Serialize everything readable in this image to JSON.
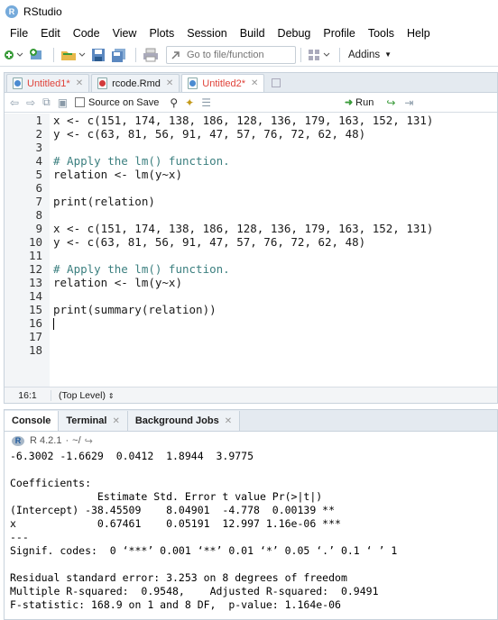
{
  "window": {
    "title": "RStudio"
  },
  "menu": [
    "File",
    "Edit",
    "Code",
    "View",
    "Plots",
    "Session",
    "Build",
    "Debug",
    "Profile",
    "Tools",
    "Help"
  ],
  "toolbar": {
    "goto_placeholder": "Go to file/function",
    "addins_label": "Addins"
  },
  "editor_tabs": [
    {
      "label": "Untitled1*",
      "modified": true
    },
    {
      "label": "rcode.Rmd",
      "modified": false
    },
    {
      "label": "Untitled2*",
      "modified": true,
      "active": true
    }
  ],
  "editor_toolbar": {
    "source_on_save": "Source on Save",
    "run_label": "Run"
  },
  "code_lines": [
    "x <- c(151, 174, 138, 186, 128, 136, 179, 163, 152, 131)",
    "y <- c(63, 81, 56, 91, 47, 57, 76, 72, 62, 48)",
    "",
    "# Apply the lm() function.",
    "relation <- lm(y~x)",
    "",
    "print(relation)",
    "",
    "x <- c(151, 174, 138, 186, 128, 136, 179, 163, 152, 131)",
    "y <- c(63, 81, 56, 91, 47, 57, 76, 72, 62, 48)",
    "",
    "# Apply the lm() function.",
    "relation <- lm(y~x)",
    "",
    "print(summary(relation))",
    "",
    "",
    ""
  ],
  "line_numbers": [
    "1",
    "2",
    "3",
    "4",
    "5",
    "6",
    "7",
    "8",
    "9",
    "10",
    "11",
    "12",
    "13",
    "14",
    "15",
    "16",
    "17",
    "18"
  ],
  "status": {
    "cursor": "16:1",
    "scope": "(Top Level)"
  },
  "console_tabs": [
    "Console",
    "Terminal",
    "Background Jobs"
  ],
  "console_header": {
    "r_version": "R 4.2.1",
    "path": "~/"
  },
  "console_lines": [
    "-6.3002 -1.6629  0.0412  1.8944  3.9775",
    "",
    "Coefficients:",
    "              Estimate Std. Error t value Pr(>|t|)",
    "(Intercept) -38.45509    8.04901  -4.778  0.00139 **",
    "x             0.67461    0.05191  12.997 1.16e-06 ***",
    "---",
    "Signif. codes:  0 ‘***’ 0.001 ‘**’ 0.01 ‘*’ 0.05 ‘.’ 0.1 ‘ ’ 1",
    "",
    "Residual standard error: 3.253 on 8 degrees of freedom",
    "Multiple R-squared:  0.9548,\tAdjusted R-squared:  0.9491",
    "F-statistic: 168.9 on 1 and 8 DF,  p-value: 1.164e-06"
  ]
}
